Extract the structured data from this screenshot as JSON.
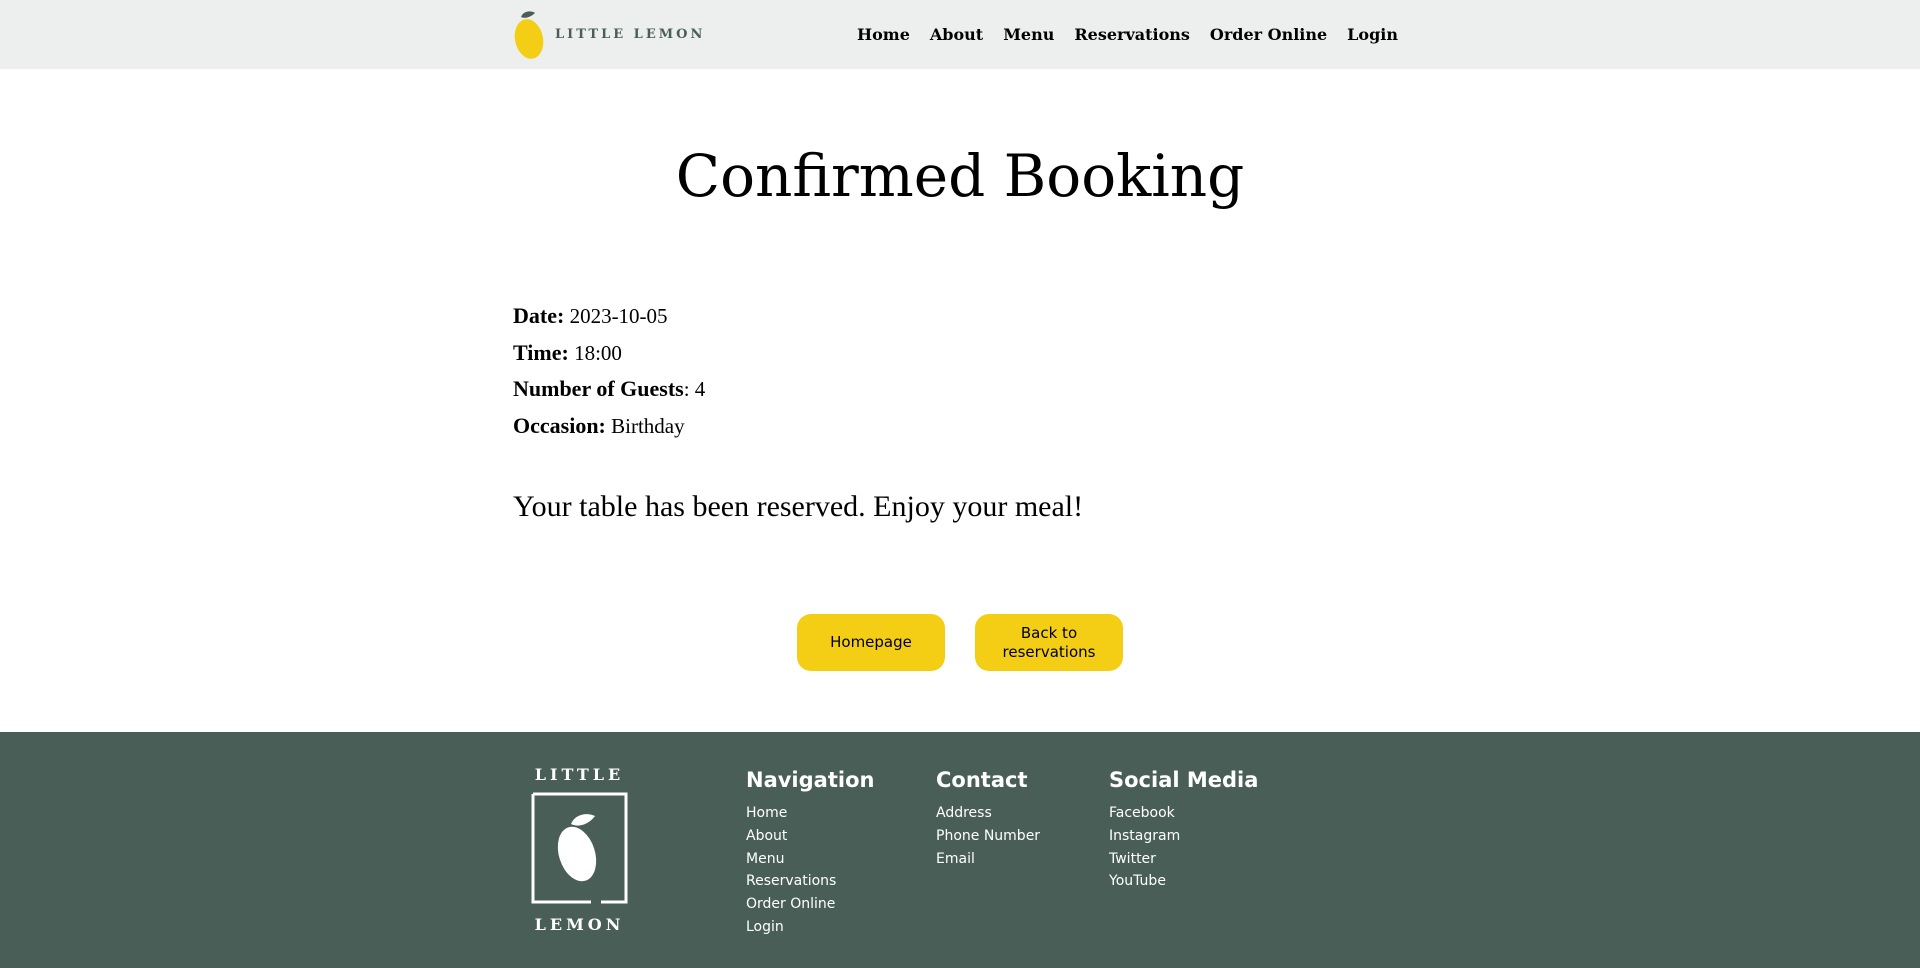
{
  "header": {
    "brand": "LITTLE LEMON",
    "nav": [
      "Home",
      "About",
      "Menu",
      "Reservations",
      "Order Online",
      "Login"
    ]
  },
  "main": {
    "title": "Confirmed Booking",
    "details": {
      "date_label": "Date:",
      "date_value": "2023-10-05",
      "time_label": "Time:",
      "time_value": "18:00",
      "guests_label": "Number of Guests",
      "guests_value": ": 4",
      "occasion_label": "Occasion:",
      "occasion_value": "Birthday"
    },
    "message": "Your table has been reserved. Enjoy your meal!",
    "buttons": {
      "homepage": "Homepage",
      "back_line1": "Back to",
      "back_line2": "reservations"
    }
  },
  "footer": {
    "logo_top": "LITTLE",
    "logo_bottom": "LEMON",
    "navigation": {
      "heading": "Navigation",
      "items": [
        "Home",
        "About",
        "Menu",
        "Reservations",
        "Order Online",
        "Login"
      ]
    },
    "contact": {
      "heading": "Contact",
      "items": [
        "Address",
        "Phone Number",
        "Email"
      ]
    },
    "social": {
      "heading": "Social Media",
      "items": [
        "Facebook",
        "Instagram",
        "Twitter",
        "YouTube"
      ]
    }
  },
  "colors": {
    "header_bg": "#edefee",
    "brand_green": "#495e57",
    "accent_yellow": "#f4ce14"
  }
}
